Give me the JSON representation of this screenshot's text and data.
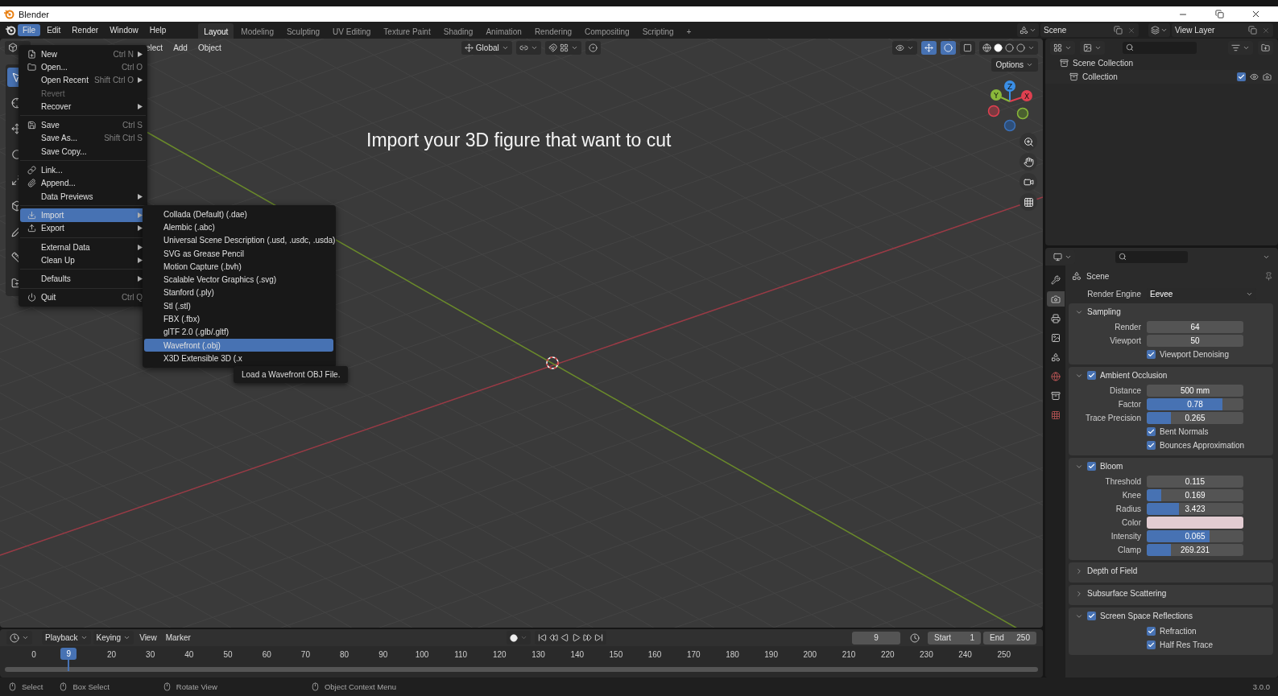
{
  "window": {
    "title": "Blender"
  },
  "menu_bar": [
    {
      "label": "File",
      "selected": true
    },
    {
      "label": "Edit",
      "selected": false
    },
    {
      "label": "Render",
      "selected": false
    },
    {
      "label": "Window",
      "selected": false
    },
    {
      "label": "Help",
      "selected": false
    }
  ],
  "workspaces": [
    {
      "label": "Layout",
      "selected": true
    },
    {
      "label": "Modeling",
      "selected": false
    },
    {
      "label": "Sculpting",
      "selected": false
    },
    {
      "label": "UV Editing",
      "selected": false
    },
    {
      "label": "Texture Paint",
      "selected": false
    },
    {
      "label": "Shading",
      "selected": false
    },
    {
      "label": "Animation",
      "selected": false
    },
    {
      "label": "Rendering",
      "selected": false
    },
    {
      "label": "Compositing",
      "selected": false
    },
    {
      "label": "Scripting",
      "selected": false
    }
  ],
  "add_workspace": "+",
  "scene": "Scene",
  "view_layer": "View Layer",
  "viewport": {
    "header_menus": [
      "elect",
      "Add",
      "Object"
    ],
    "orientation": "Global",
    "options": "Options",
    "caption": "Import your 3D figure that want to cut",
    "gizmo": {
      "z": "Z",
      "y": "Y",
      "x": "X"
    }
  },
  "file_menu": [
    [
      {
        "label": "New",
        "shortcut": "Ctrl N",
        "submenu": true,
        "disabled": false,
        "selected": false
      },
      {
        "label": "Open...",
        "shortcut": "Ctrl O",
        "submenu": false,
        "disabled": false,
        "selected": false
      },
      {
        "label": "Open Recent",
        "shortcut": "Shift Ctrl O",
        "submenu": true,
        "disabled": false,
        "selected": false
      },
      {
        "label": "Revert",
        "submenu": false,
        "disabled": true,
        "selected": false
      },
      {
        "label": "Recover",
        "submenu": true,
        "disabled": false,
        "selected": false
      }
    ],
    [
      {
        "label": "Save",
        "shortcut": "Ctrl S",
        "submenu": false,
        "disabled": false,
        "selected": false
      },
      {
        "label": "Save As...",
        "shortcut": "Shift Ctrl S",
        "submenu": false,
        "disabled": false,
        "selected": false
      },
      {
        "label": "Save Copy...",
        "submenu": false,
        "disabled": false,
        "selected": false
      }
    ],
    [
      {
        "label": "Link...",
        "submenu": false,
        "disabled": false,
        "selected": false
      },
      {
        "label": "Append...",
        "submenu": false,
        "disabled": false,
        "selected": false
      },
      {
        "label": "Data Previews",
        "submenu": true,
        "disabled": false,
        "selected": false
      }
    ],
    [
      {
        "label": "Import",
        "submenu": true,
        "disabled": false,
        "selected": true
      },
      {
        "label": "Export",
        "submenu": true,
        "disabled": false,
        "selected": false
      }
    ],
    [
      {
        "label": "External Data",
        "submenu": true,
        "disabled": false,
        "selected": false
      },
      {
        "label": "Clean Up",
        "submenu": true,
        "disabled": false,
        "selected": false
      }
    ],
    [
      {
        "label": "Defaults",
        "submenu": true,
        "disabled": false,
        "selected": false
      }
    ],
    [
      {
        "label": "Quit",
        "shortcut": "Ctrl Q",
        "submenu": false,
        "disabled": false,
        "selected": false
      }
    ]
  ],
  "import_menu": [
    {
      "label": "Collada (Default) (.dae)",
      "selected": false
    },
    {
      "label": "Alembic (.abc)",
      "selected": false
    },
    {
      "label": "Universal Scene Description (.usd, .usdc, .usda)",
      "selected": false
    },
    {
      "label": "SVG as Grease Pencil",
      "selected": false
    },
    {
      "label": "Motion Capture (.bvh)",
      "selected": false
    },
    {
      "label": "Scalable Vector Graphics (.svg)",
      "selected": false
    },
    {
      "label": "Stanford (.ply)",
      "selected": false
    },
    {
      "label": "Stl (.stl)",
      "selected": false
    },
    {
      "label": "FBX (.fbx)",
      "selected": false
    },
    {
      "label": "glTF 2.0 (.glb/.gltf)",
      "selected": false
    },
    {
      "label": "Wavefront (.obj)",
      "selected": true
    },
    {
      "label": "X3D Extensible 3D (.x",
      "selected": false
    }
  ],
  "tooltip": "Load a Wavefront OBJ File.",
  "outliner": {
    "tree": [
      {
        "label": "Scene Collection",
        "children": [
          {
            "label": "Collection",
            "checked": true
          }
        ]
      }
    ]
  },
  "properties": {
    "tabs": [
      {
        "selected": false
      },
      {
        "selected": true
      },
      {
        "selected": false
      },
      {
        "selected": false
      },
      {
        "selected": false
      },
      {
        "selected": false
      },
      {
        "selected": false
      },
      {
        "selected": false
      }
    ],
    "context": "Scene",
    "render_engine": {
      "label": "Render Engine",
      "value": "Eevee"
    },
    "panels": [
      {
        "kind": "plain",
        "title": "Sampling",
        "expanded": true,
        "rows": [
          {
            "kind": "number",
            "label": "Render",
            "value": "64"
          },
          {
            "kind": "number",
            "label": "Viewport",
            "value": "50"
          },
          {
            "kind": "checkbox",
            "label": "Viewport Denoising",
            "checked": true
          }
        ]
      },
      {
        "kind": "toggle",
        "title": "Ambient Occlusion",
        "checked": true,
        "expanded": true,
        "rows": [
          {
            "kind": "number",
            "label": "Distance",
            "value": "500 mm"
          },
          {
            "kind": "slider",
            "label": "Factor",
            "value": "0.78",
            "level": 0.78
          },
          {
            "kind": "slider",
            "label": "Trace Precision",
            "value": "0.265",
            "level": 0.25
          },
          {
            "kind": "checkbox",
            "label": "Bent Normals",
            "checked": true
          },
          {
            "kind": "checkbox",
            "label": "Bounces Approximation",
            "checked": true
          }
        ]
      },
      {
        "kind": "toggle",
        "title": "Bloom",
        "checked": true,
        "expanded": true,
        "rows": [
          {
            "kind": "number",
            "label": "Threshold",
            "value": "0.115"
          },
          {
            "kind": "slider",
            "label": "Knee",
            "value": "0.169",
            "level": 0.15
          },
          {
            "kind": "slider",
            "label": "Radius",
            "value": "3.423",
            "level": 0.33
          },
          {
            "kind": "color",
            "label": "Color",
            "color": "#e2ccd2"
          },
          {
            "kind": "slider",
            "label": "Intensity",
            "value": "0.065",
            "level": 0.65
          },
          {
            "kind": "slider",
            "label": "Clamp",
            "value": "269.231",
            "level": 0.25
          }
        ]
      },
      {
        "kind": "plain",
        "title": "Depth of Field",
        "expanded": false
      },
      {
        "kind": "plain",
        "title": "Subsurface Scattering",
        "expanded": false
      },
      {
        "kind": "toggle",
        "title": "Screen Space Reflections",
        "checked": true,
        "expanded": true,
        "rows": [
          {
            "kind": "checkbox",
            "label": "Refraction",
            "checked": true
          },
          {
            "kind": "checkbox",
            "label": "Half Res Trace",
            "checked": true
          }
        ]
      }
    ]
  },
  "timeline": {
    "menus": [
      {
        "label": "Playback",
        "dropdown": true
      },
      {
        "label": "Keying",
        "dropdown": true
      },
      {
        "label": "View",
        "dropdown": false
      },
      {
        "label": "Marker",
        "dropdown": false
      }
    ],
    "current_frame": "9",
    "start": {
      "label": "Start",
      "value": "1"
    },
    "end": {
      "label": "End",
      "value": "250"
    },
    "ruler": [
      "0",
      "20",
      "30",
      "40",
      "50",
      "60",
      "70",
      "80",
      "90",
      "100",
      "110",
      "120",
      "130",
      "140",
      "150",
      "160",
      "170",
      "180",
      "190",
      "200",
      "210",
      "220",
      "230",
      "240",
      "250"
    ],
    "playhead": {
      "label": "9",
      "level": 0.036
    }
  },
  "status_bar": {
    "hints": [
      "Select",
      "Box Select",
      "Rotate View",
      "Object Context Menu"
    ],
    "version": "3.0.0"
  }
}
